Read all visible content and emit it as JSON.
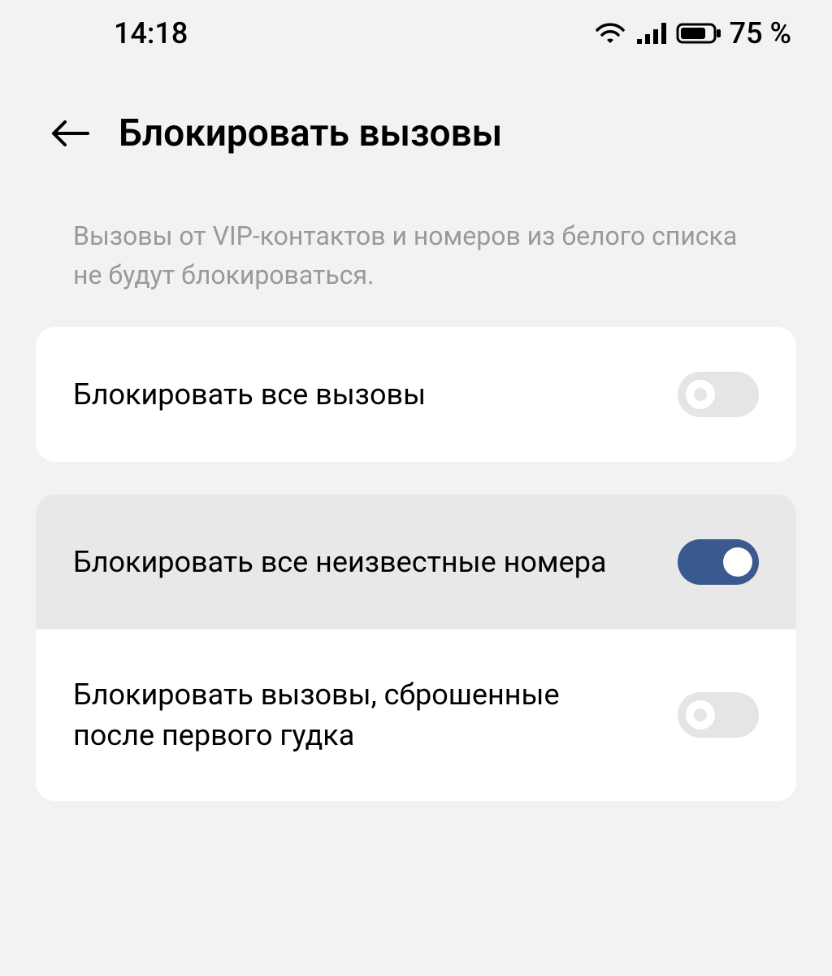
{
  "statusBar": {
    "time": "14:18",
    "battery": "75 %"
  },
  "header": {
    "title": "Блокировать вызовы"
  },
  "description": "Вызовы от VIP-контактов и номеров из белого списка не будут блокироваться.",
  "settings": {
    "blockAll": {
      "label": "Блокировать все вызовы",
      "enabled": false
    },
    "blockUnknown": {
      "label": "Блокировать все неизвестные номера",
      "enabled": true
    },
    "blockOneRing": {
      "label": "Блокировать вызовы, сброшенные после первого гудка",
      "enabled": false
    }
  }
}
